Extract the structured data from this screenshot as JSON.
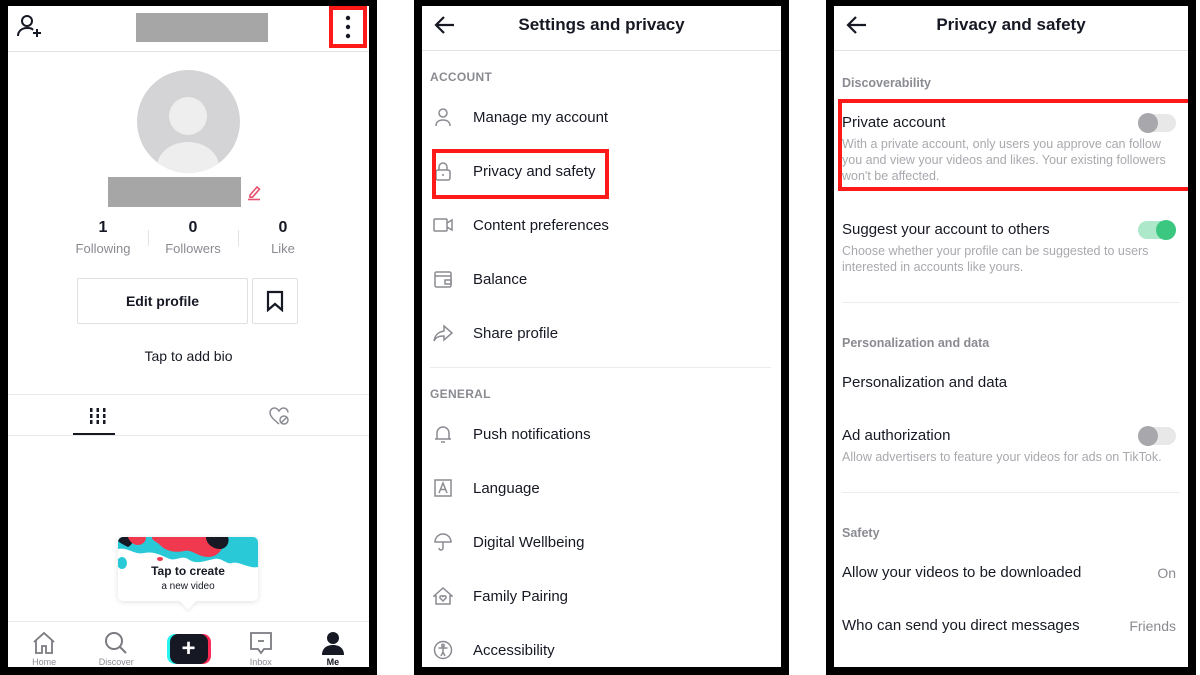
{
  "colors": {
    "highlight": "#ff1a1a",
    "toggle_on": "#3bc77f",
    "toggle_off": "#a8a8ac",
    "text_primary": "#161823",
    "text_secondary": "#8a8b91",
    "tiktok_cyan": "#25f4ee",
    "tiktok_red": "#fe2c55"
  },
  "profile": {
    "header": {
      "add_user_icon": "person-add-icon",
      "more_icon": "more-vertical-icon",
      "username_redacted": true
    },
    "name_redacted": true,
    "edit_icon": "pencil-icon",
    "stats": [
      {
        "value": "1",
        "label": "Following"
      },
      {
        "value": "0",
        "label": "Followers"
      },
      {
        "value": "0",
        "label": "Like"
      }
    ],
    "edit_profile_label": "Edit profile",
    "bookmark_icon": "bookmark-icon",
    "bio_prompt": "Tap to add bio",
    "tabs": [
      {
        "icon": "grid-icon",
        "active": true
      },
      {
        "icon": "liked-hidden-icon",
        "active": false
      }
    ],
    "create_tip": {
      "title": "Tap to create",
      "subtitle": "a new video"
    },
    "bottom_nav": [
      {
        "label": "Home",
        "icon": "home-icon"
      },
      {
        "label": "Discover",
        "icon": "search-icon"
      },
      {
        "label": "",
        "icon": "plus-icon"
      },
      {
        "label": "Inbox",
        "icon": "inbox-icon"
      },
      {
        "label": "Me",
        "icon": "person-icon",
        "active": true
      }
    ]
  },
  "settings": {
    "title": "Settings and privacy",
    "sections": [
      {
        "label": "ACCOUNT",
        "items": [
          {
            "label": "Manage my account",
            "icon": "person-icon"
          },
          {
            "label": "Privacy and safety",
            "icon": "lock-icon",
            "highlighted": true
          },
          {
            "label": "Content preferences",
            "icon": "video-camera-icon"
          },
          {
            "label": "Balance",
            "icon": "wallet-icon"
          },
          {
            "label": "Share profile",
            "icon": "share-icon"
          }
        ]
      },
      {
        "label": "GENERAL",
        "items": [
          {
            "label": "Push notifications",
            "icon": "bell-icon"
          },
          {
            "label": "Language",
            "icon": "language-icon"
          },
          {
            "label": "Digital Wellbeing",
            "icon": "umbrella-icon"
          },
          {
            "label": "Family Pairing",
            "icon": "house-heart-icon"
          },
          {
            "label": "Accessibility",
            "icon": "accessibility-icon"
          }
        ]
      }
    ]
  },
  "privacy": {
    "title": "Privacy and safety",
    "sections": [
      {
        "label": "Discoverability",
        "rows": [
          {
            "title": "Private account",
            "desc": "With a private account, only users you approve can follow you and view your videos and likes. Your existing followers won't be affected.",
            "toggle": false,
            "highlighted": true
          },
          {
            "title": "Suggest your account to others",
            "desc": "Choose whether your profile can be suggested to users interested in accounts like yours.",
            "toggle": true
          }
        ]
      },
      {
        "label": "Personalization and data",
        "rows": [
          {
            "title": "Personalization and data"
          },
          {
            "title": "Ad authorization",
            "desc": "Allow advertisers to feature your videos for ads on TikTok.",
            "toggle": false
          }
        ]
      },
      {
        "label": "Safety",
        "rows": [
          {
            "title": "Allow your videos to be downloaded",
            "value": "On"
          },
          {
            "title": "Who can send you direct messages",
            "value": "Friends"
          }
        ]
      }
    ]
  }
}
